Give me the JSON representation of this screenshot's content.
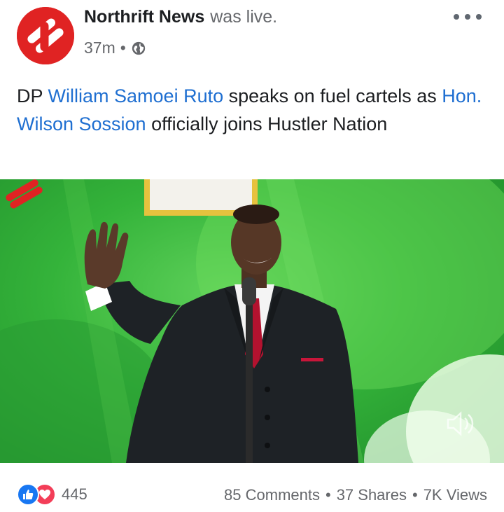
{
  "post": {
    "page_name": "Northrift News",
    "status_suffix": "was live.",
    "time": "37m",
    "separator": "•",
    "privacy_icon": "globe-icon"
  },
  "caption": {
    "part1": "DP ",
    "link1": "William Samoei Ruto",
    "part2": "  speaks on fuel cartels as ",
    "link2": "Hon. Wilson Sossion",
    "part3": "  officially joins Hustler Nation"
  },
  "video": {
    "watermark_icon": "northrift-logo-icon",
    "mute_icon": "speaker-muted-icon"
  },
  "footer": {
    "reaction_count": "445",
    "comments": "85 Comments",
    "shares": "37 Shares",
    "views": "7K Views",
    "dot": "•"
  },
  "colors": {
    "brand_red": "#e02323",
    "link_blue": "#1f6fd1",
    "like_blue": "#1877f2",
    "love_red": "#f33e58",
    "video_green": "#34b33a"
  }
}
